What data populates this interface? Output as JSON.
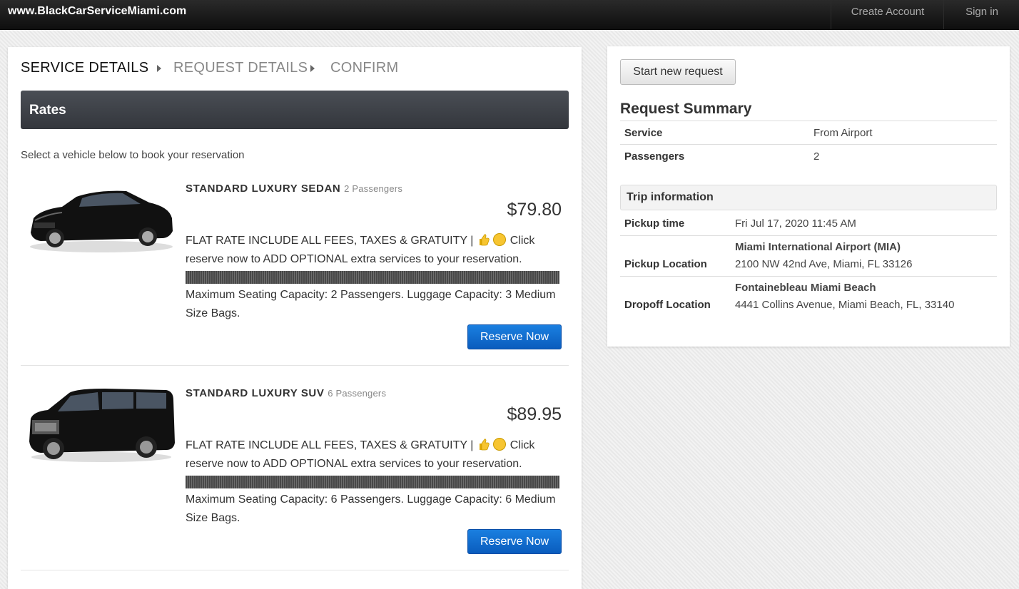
{
  "header": {
    "brand": "www.BlackCarServiceMiami.com",
    "create_account": "Create Account",
    "sign_in": "Sign in"
  },
  "steps": [
    "SERVICE DETAILS",
    "REQUEST DETAILS",
    "CONFIRM"
  ],
  "rates": {
    "title": "Rates",
    "intro": "Select a vehicle below to book your reservation"
  },
  "vehicles": [
    {
      "name": "STANDARD LUXURY SEDAN",
      "passengers": "2 Passengers",
      "price": "$79.80",
      "desc_line1": "FLAT RATE INCLUDE ALL FEES, TAXES & GRATUITY |",
      "desc_line1_end": "Click",
      "desc_line2": "reserve now to ADD OPTIONAL extra services to your reservation.",
      "capacity": "Maximum Seating Capacity: 2 Passengers. Luggage Capacity: 3 Medium Size Bags.",
      "button": "Reserve Now",
      "image_icon": "sedan-image"
    },
    {
      "name": "STANDARD LUXURY SUV",
      "passengers": "6 Passengers",
      "price": "$89.95",
      "desc_line1": "FLAT RATE INCLUDE ALL FEES, TAXES & GRATUITY |",
      "desc_line1_end": "Click",
      "desc_line2": "reserve now to ADD OPTIONAL extra services to your reservation.",
      "capacity": "Maximum Seating Capacity: 6 Passengers. Luggage Capacity: 6 Medium Size Bags.",
      "button": "Reserve Now",
      "image_icon": "suv-image"
    }
  ],
  "summary": {
    "new_request_button": "Start new request",
    "title": "Request Summary",
    "service_label": "Service",
    "service_value": "From Airport",
    "passengers_label": "Passengers",
    "passengers_value": "2",
    "trip_header": "Trip information",
    "pickup_time_label": "Pickup time",
    "pickup_time_value": "Fri Jul 17, 2020 11:45 AM",
    "pickup_location_label": "Pickup Location",
    "pickup_location_name": "Miami International Airport (MIA)",
    "pickup_location_address": "2100 NW 42nd Ave, Miami, FL 33126",
    "dropoff_location_label": "Dropoff Location",
    "dropoff_location_name": "Fontainebleau Miami Beach",
    "dropoff_location_address": "4441 Collins Avenue, Miami Beach, FL, 33140"
  }
}
